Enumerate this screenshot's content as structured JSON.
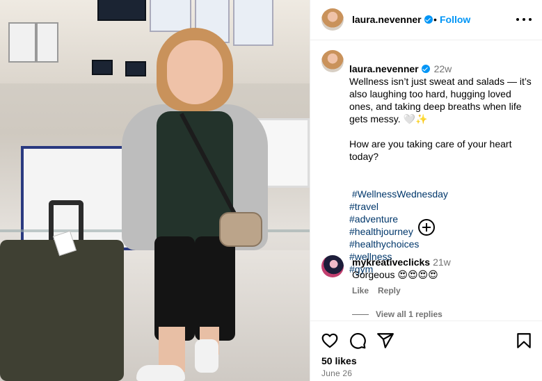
{
  "post": {
    "author": "laura.nevenner",
    "follow_label": "Follow",
    "separator": "•",
    "caption_time": "22w",
    "caption_lines": [
      "Wellness isn’t just sweat and salads — it’s also laughing too hard, hugging loved ones, and taking deep breaths when life gets messy. 🤍✨",
      "",
      "How are you taking care of your heart today?"
    ],
    "hashtags": [
      "#WellnessWednesday",
      "#travel",
      "#adventure",
      "#healthjourney",
      "#healthychoices",
      "#wellness",
      "#gym"
    ]
  },
  "comment": {
    "author": "mykreativeclicks",
    "time": "21w",
    "text": "Gorgeous 😍😍😍😍",
    "like_label": "Like",
    "reply_label": "Reply",
    "view_replies_label": "View all 1 replies"
  },
  "footer": {
    "likes": "50 likes",
    "date": "June 26"
  },
  "icons": [
    "more-options-icon",
    "verified-icon",
    "add-comment-icon",
    "heart-icon",
    "comment-icon",
    "share-icon",
    "bookmark-icon"
  ],
  "colors": {
    "link": "#0095f6",
    "hashtag": "#00376b",
    "muted": "#737373"
  }
}
